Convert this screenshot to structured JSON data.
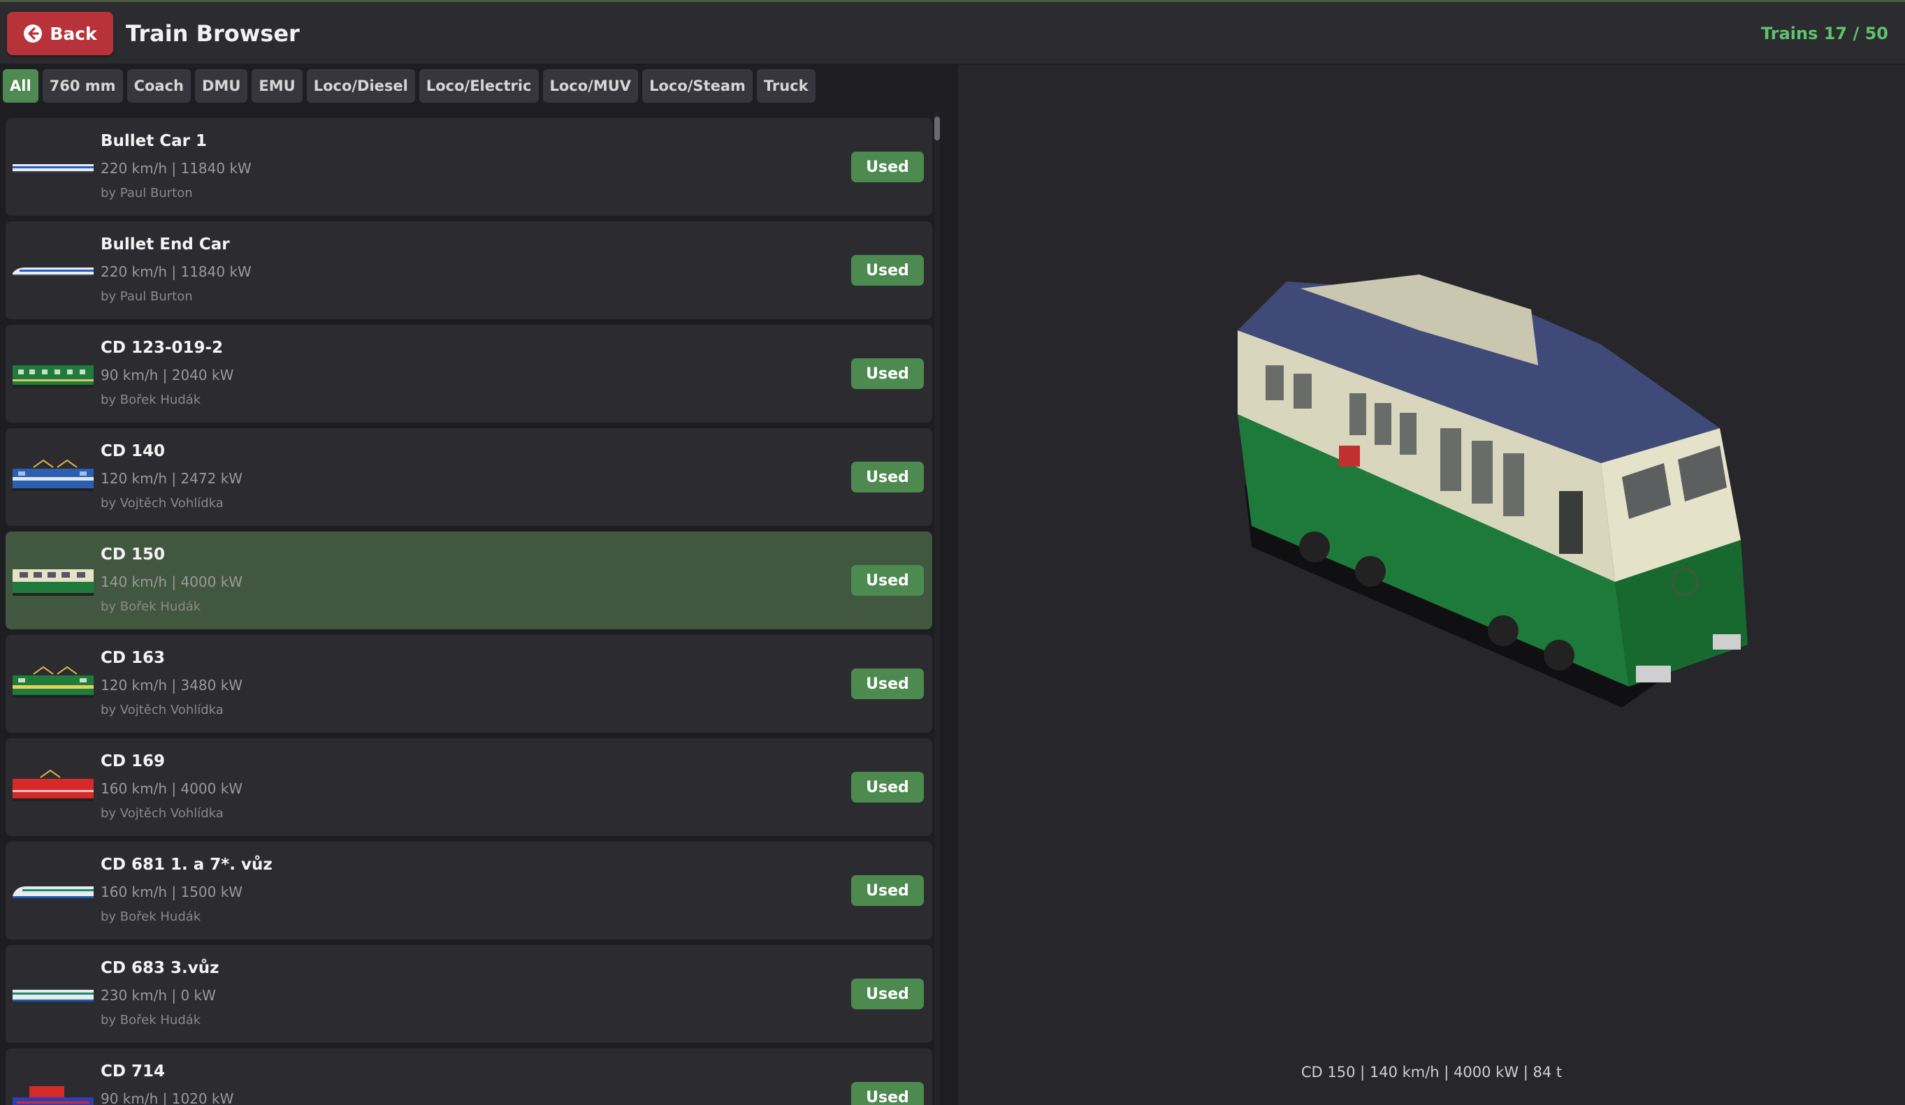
{
  "header": {
    "back_label": "Back",
    "title": "Train Browser",
    "count": "Trains 17 / 50"
  },
  "filters": [
    "All",
    "760 mm",
    "Coach",
    "DMU",
    "EMU",
    "Loco/Diesel",
    "Loco/Electric",
    "Loco/MUV",
    "Loco/Steam",
    "Truck"
  ],
  "active_filter": "All",
  "trains": [
    {
      "name": "Bullet Car 1",
      "specs": "220 km/h | 11840 kW",
      "author": "by Paul Burton",
      "status": "Used",
      "thumb": "bullet-white"
    },
    {
      "name": "Bullet End Car",
      "specs": "220 km/h | 11840 kW",
      "author": "by Paul Burton",
      "status": "Used",
      "thumb": "bullet-end"
    },
    {
      "name": "CD 123-019-2",
      "specs": "90 km/h | 2040 kW",
      "author": "by Bořek Hudák",
      "status": "Used",
      "thumb": "green-loco"
    },
    {
      "name": "CD 140",
      "specs": "120 km/h | 2472 kW",
      "author": "by Vojtěch Vohlídka",
      "status": "Used",
      "thumb": "blue-loco"
    },
    {
      "name": "CD 150",
      "specs": "140 km/h | 4000 kW",
      "author": "by Bořek Hudák",
      "status": "Used",
      "thumb": "green-cream-loco",
      "selected": true
    },
    {
      "name": "CD 163",
      "specs": "120 km/h | 3480 kW",
      "author": "by Vojtěch Vohlídka",
      "status": "Used",
      "thumb": "green-yellow-loco"
    },
    {
      "name": "CD 169",
      "specs": "160 km/h | 4000 kW",
      "author": "by Vojtěch Vohlídka",
      "status": "Used",
      "thumb": "red-loco"
    },
    {
      "name": "CD 681 1. a 7*. vůz",
      "specs": "160 km/h | 1500 kW",
      "author": "by Bořek Hudák",
      "status": "Used",
      "thumb": "pendolino-end"
    },
    {
      "name": "CD 683 3.vůz",
      "specs": "230 km/h | 0 kW",
      "author": "by Bořek Hudák",
      "status": "Used",
      "thumb": "pendolino-car"
    },
    {
      "name": "CD 714",
      "specs": "90 km/h | 1020 kW",
      "author": "",
      "status": "Used",
      "thumb": "red-blue-loco"
    }
  ],
  "preview": {
    "caption": "CD 150 | 140 km/h | 4000 kW | 84 t"
  },
  "colors": {
    "accent_green": "#4c8a50",
    "count_green": "#5cc46a",
    "back_red": "#b8323a",
    "selected_row": "#41573f"
  }
}
